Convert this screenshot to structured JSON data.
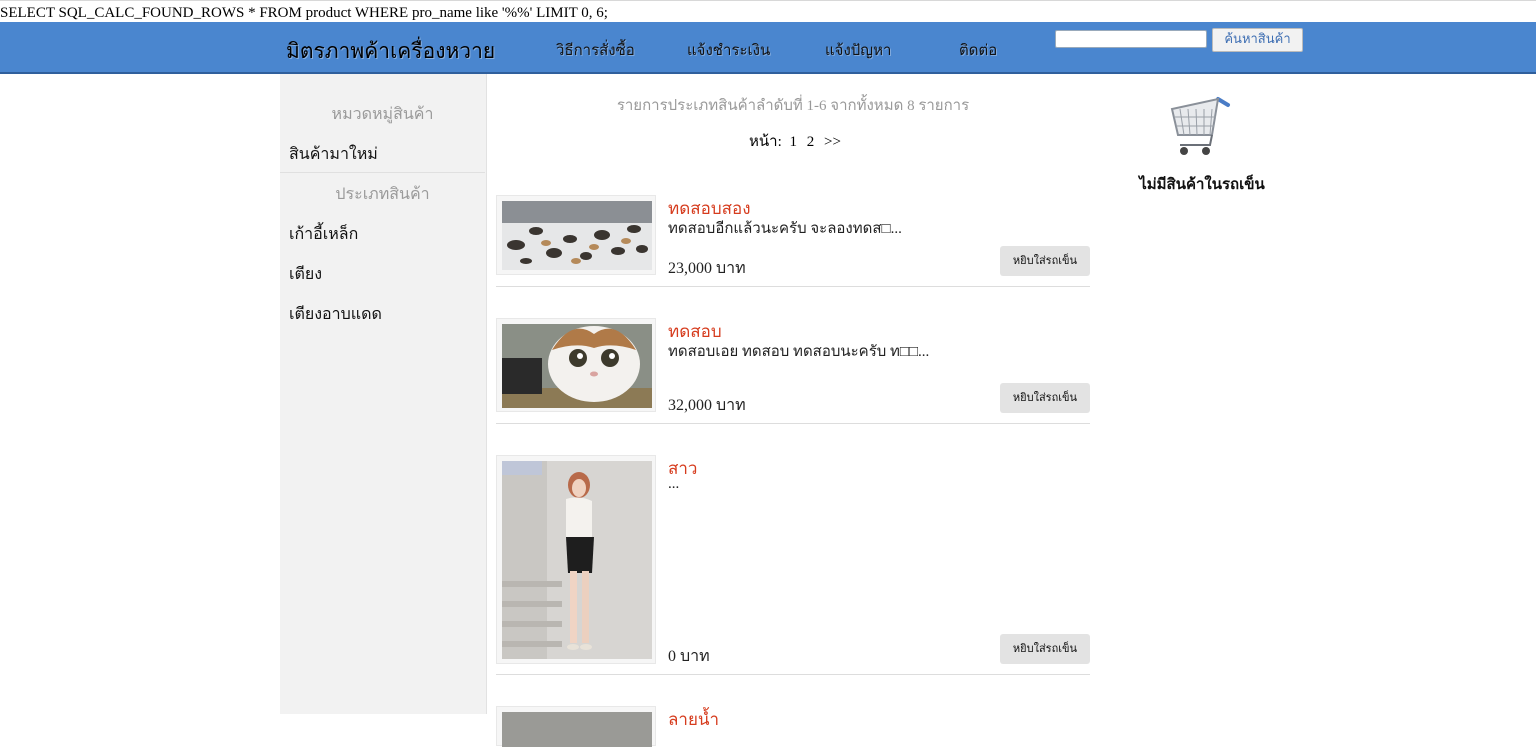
{
  "debug": {
    "sql": "SELECT SQL_CALC_FOUND_ROWS * FROM product WHERE pro_name like '%%' LIMIT 0, 6;"
  },
  "header": {
    "brand": "มิตรภาพค้าเครื่องหวาย",
    "nav": [
      {
        "label": "วิธีการสั่งซื้อ"
      },
      {
        "label": "แจ้งชำระเงิน"
      },
      {
        "label": "แจ้งปัญหา"
      },
      {
        "label": "ติดต่อ"
      }
    ],
    "search": {
      "value": "",
      "button_label": "ค้นหาสินค้า"
    }
  },
  "sidebar": {
    "category_heading": "หมวดหมู่สินค้า",
    "new_products": "สินค้ามาใหม่",
    "type_heading": "ประเภทสินค้า",
    "types": [
      {
        "label": "เก้าอี้เหล็ก"
      },
      {
        "label": "เตียง"
      },
      {
        "label": "เตียงอาบแดด"
      }
    ]
  },
  "listing": {
    "summary": "รายการประเภทสินค้าลำดับที่ 1-6 จากทั้งหมด 8 รายการ",
    "pager": {
      "label": "หน้า:",
      "pages": [
        "1",
        "2"
      ],
      "next": ">>"
    }
  },
  "products": [
    {
      "name": "ทดสอบสอง",
      "desc": "ทดสอบอีกแล้วนะครับ จะลองทดส□...",
      "price": "23,000 บาท",
      "button": "หยิบใส่รถเข็น",
      "image": "cats-group-photo"
    },
    {
      "name": "ทดสอบ",
      "desc": "ทดสอบเอย ทดสอบ ทดสอบนะครับ ท□□...",
      "price": "32,000 บาท",
      "button": "หยิบใส่รถเข็น",
      "image": "cat-closeup-photo"
    },
    {
      "name": "สาว",
      "desc": "...",
      "price": "0 บาท",
      "button": "หยิบใส่รถเข็น",
      "image": "woman-standing-photo"
    },
    {
      "name": "ลายน้ำ",
      "desc": "",
      "price": "",
      "button": "",
      "image": "photo"
    }
  ],
  "cart": {
    "icon": "shopping-cart-icon",
    "empty_text": "ไม่มีสินค้าในรถเข็น"
  },
  "colors": {
    "nav_bg": "#4a86cf",
    "product_name": "#d63c1e",
    "sidebar_bg": "#f2f2f2"
  }
}
